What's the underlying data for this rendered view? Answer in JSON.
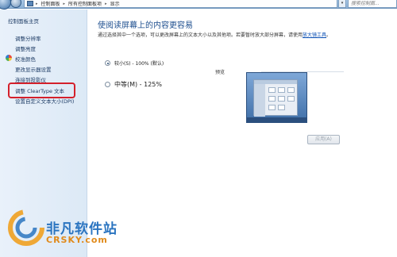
{
  "address_bar": {
    "crumbs": [
      "控制面板",
      "所有控制面板项",
      "显示"
    ],
    "search_placeholder": "搜索控制面..."
  },
  "sidebar": {
    "items": [
      {
        "label": "控制面板主页"
      },
      {
        "label": "调整分辨率"
      },
      {
        "label": "调整亮度"
      },
      {
        "label": "校准颜色"
      },
      {
        "label": "更改显示器设置"
      },
      {
        "label": "连接到投影仪"
      },
      {
        "label": "调整 ClearType 文本"
      },
      {
        "label": "设置自定义文本大小(DPI)"
      }
    ]
  },
  "main": {
    "title": "使阅读屏幕上的内容更容易",
    "description": "通过选择其中一个选项，可以更改屏幕上的文本大小以及其他项。若要暂时放大部分屏幕，请使用",
    "description_link": "放大镜工具",
    "description_end": "。",
    "options": [
      {
        "label": "较小(S) - 100% (默认)",
        "selected": true
      },
      {
        "label": "中等(M) - 125%",
        "selected": false
      }
    ],
    "preview_label": "预览",
    "apply_label": "应用(A)"
  },
  "watermark": {
    "title": "非凡软件站",
    "url": "CRSKY.com"
  },
  "colors": {
    "accent": "#1e4f8f",
    "highlight": "#d4202b",
    "link": "#0a4fb4"
  }
}
